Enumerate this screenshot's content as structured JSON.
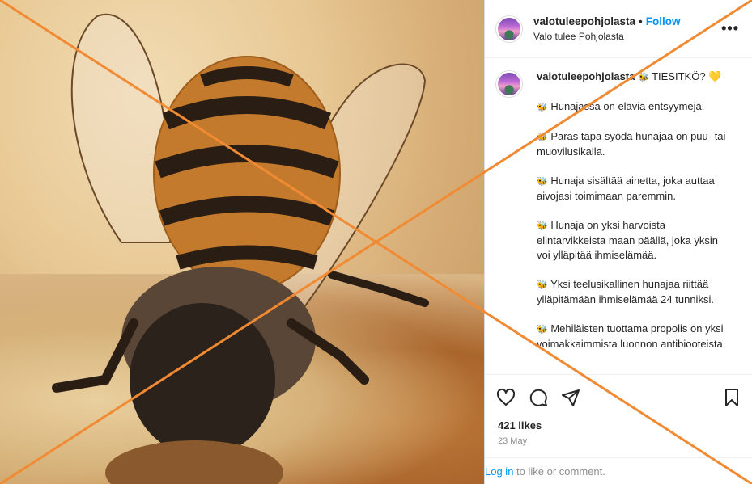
{
  "header": {
    "username": "valotuleepohjolasta",
    "separator": "•",
    "follow_label": "Follow",
    "subtitle": "Valo tulee Pohjolasta",
    "more_label": "•••"
  },
  "caption": {
    "username": "valotuleepohjolasta",
    "title": "TIESITKÖ?",
    "title_emoji_lead": "🐝",
    "title_emoji_trail": "💛",
    "paragraphs": [
      "Hunajassa on eläviä entsyymejä.",
      "Paras tapa syödä hunajaa on puu- tai muovilusikalla.",
      "Hunaja sisältää ainetta, joka auttaa aivojasi toimimaan paremmin.",
      "Hunaja on yksi harvoista elintarvikkeista maan päällä, joka yksin voi ylläpitää ihmiselämää.",
      "Yksi teelusikallinen hunajaa riittää ylläpitämään ihmiselämää 24 tunniksi.",
      "Mehiläisten tuottama propolis on yksi voimakkaimmista luonnon antibiooteista."
    ],
    "bullet_emoji": "🐝"
  },
  "post": {
    "likes": "421 likes",
    "date": "23 May",
    "login_link": "Log in",
    "login_rest": " to like or comment."
  },
  "icons": {
    "like": "heart-icon",
    "comment": "comment-icon",
    "share": "paper-plane-icon",
    "save": "bookmark-icon"
  },
  "colors": {
    "follow": "#0095f6",
    "overlay_cross": "#f08a33"
  }
}
